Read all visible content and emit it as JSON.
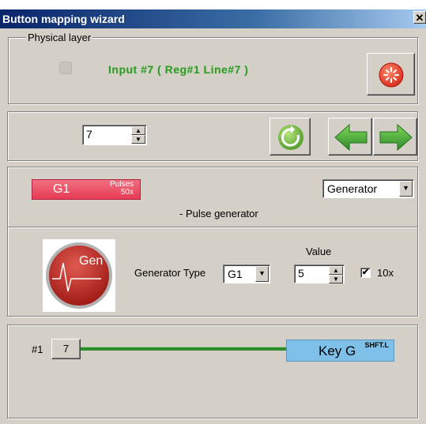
{
  "window": {
    "title": "Button mapping wizard",
    "close_glyph": "✕"
  },
  "physical_layer": {
    "legend": "Physical layer",
    "input_label": "Input #7  ( Reg#1  Line#7 )",
    "record_icon": "record-icon"
  },
  "nav": {
    "spin_value": "7",
    "refresh_icon": "refresh-icon",
    "back_icon": "arrow-left-icon",
    "forward_icon": "arrow-right-icon"
  },
  "function": {
    "badge_name": "G1",
    "badge_small_1": "Pulses",
    "badge_small_2": "50x",
    "type_select": "Generator",
    "description": "- Pulse generator",
    "gen_icon_label": "Gen",
    "generator_type_label": "Generator Type",
    "generator_type_value": "G1",
    "value_label": "Value",
    "value": "5",
    "ten_x_label": "10x",
    "ten_x_checked": true
  },
  "mapping": {
    "index_label": "#1",
    "input_number": "7",
    "key_name": "Key G",
    "key_modifier": "SHFT.L",
    "line_color": "#2e8b2e"
  }
}
